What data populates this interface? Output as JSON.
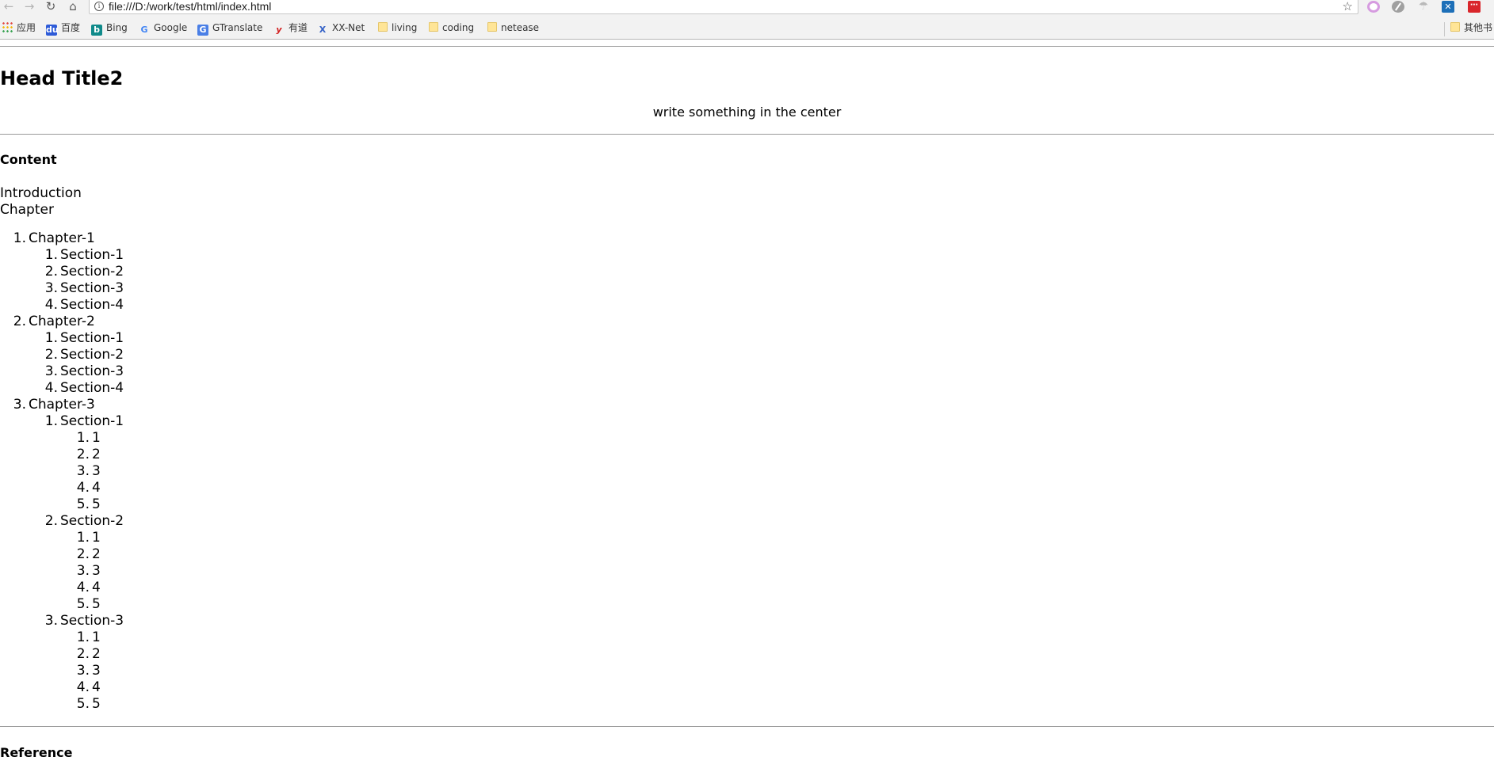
{
  "browser": {
    "url": "file:///D:/work/test/html/index.html",
    "bookmarks": [
      {
        "label": "应用",
        "icon": "apps-grid-icon"
      },
      {
        "label": "百度",
        "icon": "baidu-icon"
      },
      {
        "label": "Bing",
        "icon": "bing-icon"
      },
      {
        "label": "Google",
        "icon": "google-icon"
      },
      {
        "label": "GTranslate",
        "icon": "gtranslate-icon"
      },
      {
        "label": "有道",
        "icon": "youdao-icon"
      },
      {
        "label": "XX-Net",
        "icon": "xxnet-icon"
      },
      {
        "label": "living",
        "icon": "folder-icon"
      },
      {
        "label": "coding",
        "icon": "folder-icon"
      },
      {
        "label": "netease",
        "icon": "folder-icon"
      },
      {
        "label": "其他书",
        "icon": "folder-icon"
      }
    ]
  },
  "page": {
    "title": "Head Title2",
    "center_text": "write something in the center",
    "content_heading": "Content",
    "intro": "Introduction",
    "chapter_label": "Chapter",
    "reference_heading": "Reference"
  },
  "toc": [
    {
      "num": "1.",
      "label": "Chapter-1",
      "sections": [
        {
          "num": "1.",
          "label": "Section-1",
          "items": []
        },
        {
          "num": "2.",
          "label": "Section-2",
          "items": []
        },
        {
          "num": "3.",
          "label": "Section-3",
          "items": []
        },
        {
          "num": "4.",
          "label": "Section-4",
          "items": []
        }
      ]
    },
    {
      "num": "2.",
      "label": "Chapter-2",
      "sections": [
        {
          "num": "1.",
          "label": "Section-1",
          "items": []
        },
        {
          "num": "2.",
          "label": "Section-2",
          "items": []
        },
        {
          "num": "3.",
          "label": "Section-3",
          "items": []
        },
        {
          "num": "4.",
          "label": "Section-4",
          "items": []
        }
      ]
    },
    {
      "num": "3.",
      "label": "Chapter-3",
      "sections": [
        {
          "num": "1.",
          "label": "Section-1",
          "items": [
            {
              "num": "1.",
              "label": "1"
            },
            {
              "num": "2.",
              "label": "2"
            },
            {
              "num": "3.",
              "label": "3"
            },
            {
              "num": "4.",
              "label": "4"
            },
            {
              "num": "5.",
              "label": "5"
            }
          ]
        },
        {
          "num": "2.",
          "label": "Section-2",
          "items": [
            {
              "num": "1.",
              "label": "1"
            },
            {
              "num": "2.",
              "label": "2"
            },
            {
              "num": "3.",
              "label": "3"
            },
            {
              "num": "4.",
              "label": "4"
            },
            {
              "num": "5.",
              "label": "5"
            }
          ]
        },
        {
          "num": "3.",
          "label": "Section-3",
          "items": [
            {
              "num": "1.",
              "label": "1"
            },
            {
              "num": "2.",
              "label": "2"
            },
            {
              "num": "3.",
              "label": "3"
            },
            {
              "num": "4.",
              "label": "4"
            },
            {
              "num": "5.",
              "label": "5"
            }
          ]
        }
      ]
    }
  ]
}
